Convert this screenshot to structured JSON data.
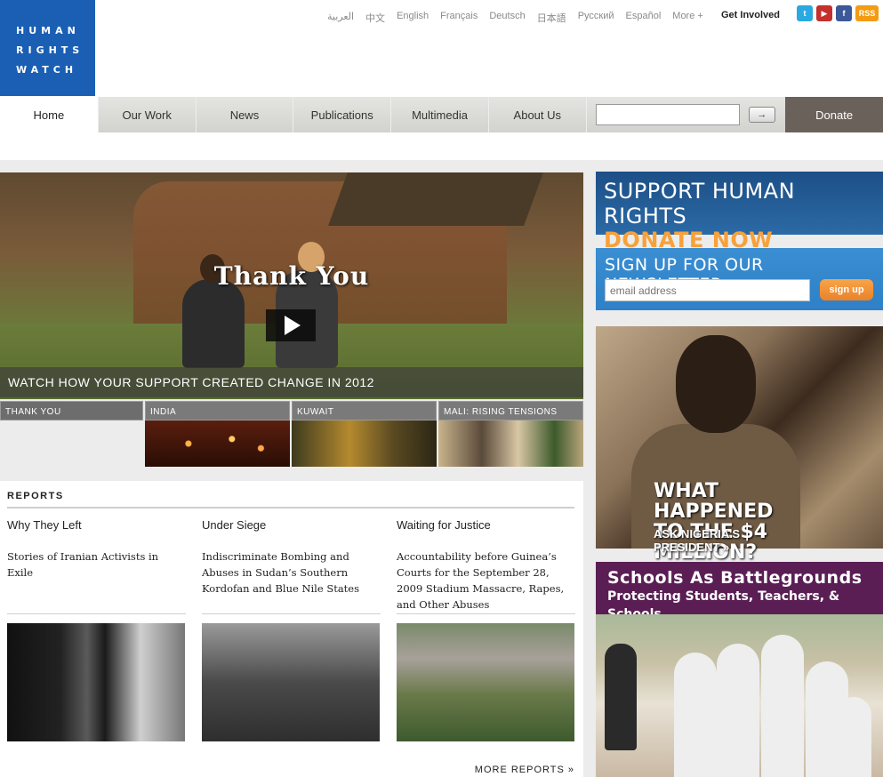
{
  "logo": {
    "lines": [
      "HUMAN",
      "RIGHTS",
      "WATCH"
    ],
    "color": "#1a5fb4"
  },
  "languages": [
    "العربية",
    "中文",
    "English",
    "Français",
    "Deutsch",
    "日本語",
    "Русский",
    "Español",
    "More +"
  ],
  "header": {
    "get_involved": "Get Involved",
    "rss": "RSS"
  },
  "social_icons": [
    "twitter-icon",
    "youtube-icon",
    "facebook-icon",
    "rss-icon"
  ],
  "nav": {
    "items": [
      "Home",
      "Our Work",
      "News",
      "Publications",
      "Multimedia",
      "About Us"
    ],
    "active": "Home",
    "search_value": "",
    "go_label": "→",
    "donate_label": "Donate"
  },
  "hero": {
    "title": "Thank You",
    "caption": "WATCH HOW YOUR SUPPORT CREATED CHANGE IN 2012"
  },
  "thumbnails": [
    {
      "label": "THANK YOU",
      "selected": true
    },
    {
      "label": "INDIA"
    },
    {
      "label": "KUWAIT"
    },
    {
      "label": "MALI: RISING TENSIONS"
    }
  ],
  "reports": {
    "heading": "REPORTS",
    "items": [
      {
        "title": "Why They Left",
        "description": "Stories of Iranian Activists in Exile"
      },
      {
        "title": "Under Siege",
        "description": "Indiscriminate Bombing and Abuses in Sudan’s Southern Kordofan and Blue Nile States"
      },
      {
        "title": "Waiting for Justice",
        "description": "Accountability before Guinea’s Courts for the September 28, 2009 Stadium Massacre, Rapes, and Other Abuses"
      }
    ],
    "more_link": "MORE REPORTS »"
  },
  "sidebar": {
    "support": {
      "line1": "SUPPORT HUMAN RIGHTS",
      "line2": "DONATE NOW"
    },
    "newsletter": {
      "heading": "SIGN UP FOR OUR NEWSLETTER",
      "placeholder": "email address",
      "button": "sign up"
    },
    "nigeria": {
      "line1": "WHAT HAPPENED",
      "line2": "TO THE $4 MILLION?",
      "line3": "ASK NIGERIA'S PRESIDENT »"
    },
    "schools": {
      "title": "Schools As Battlegrounds",
      "subtitle": "Protecting Students, Teachers, & Schools"
    }
  },
  "colors": {
    "accent_blue": "#1a5fb4",
    "donate_orange": "#f7a13a",
    "schools_purple": "#5a1e55",
    "donate_nav": "#6a625a"
  }
}
